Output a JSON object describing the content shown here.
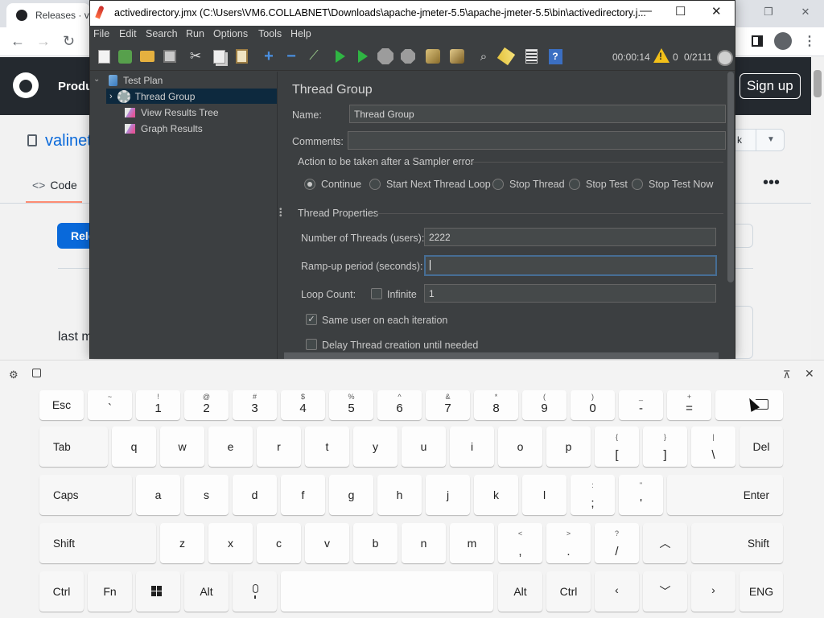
{
  "browser": {
    "tab_title": "Releases · va",
    "signup": "Sign up",
    "product_label": "Produ",
    "repo_name": "valinet",
    "code_tab": "Code",
    "releases_btn": "Rele",
    "last_text": "last m",
    "star_btn_text": "k"
  },
  "jmeter": {
    "window_title": "activedirectory.jmx (C:\\Users\\VM6.COLLABNET\\Downloads\\apache-jmeter-5.5\\apache-jmeter-5.5\\bin\\activedirectory.j...",
    "menu": [
      "File",
      "Edit",
      "Search",
      "Run",
      "Options",
      "Tools",
      "Help"
    ],
    "timer": "00:00:14",
    "error_count": "0",
    "threads": "0/2111",
    "tree": [
      {
        "label": "Test Plan",
        "icon": "test-plan-icon"
      },
      {
        "label": "Thread Group",
        "icon": "gear-icon",
        "selected": true
      },
      {
        "label": "View Results Tree",
        "icon": "graph-icon"
      },
      {
        "label": "Graph Results",
        "icon": "graph-icon"
      }
    ],
    "panel": {
      "heading": "Thread Group",
      "name_label": "Name:",
      "name_value": "Thread Group",
      "comments_label": "Comments:",
      "comments_value": "",
      "error_action_title": "Action to be taken after a Sampler error",
      "error_actions": [
        "Continue",
        "Start Next Thread Loop",
        "Stop Thread",
        "Stop Test",
        "Stop Test Now"
      ],
      "error_action_selected": "Continue",
      "props_title": "Thread Properties",
      "threads_label": "Number of Threads (users):",
      "threads_value": "2222",
      "rampup_label": "Ramp-up period (seconds):",
      "rampup_value": "",
      "loop_label": "Loop Count:",
      "infinite_label": "Infinite",
      "infinite_checked": false,
      "loop_value": "1",
      "same_user_label": "Same user on each iteration",
      "same_user_checked": true,
      "delay_label": "Delay Thread creation until needed",
      "delay_checked": false
    }
  },
  "keyboard": {
    "row1": [
      {
        "main": "Esc"
      },
      {
        "shift": "~",
        "main": "`"
      },
      {
        "shift": "!",
        "main": "1"
      },
      {
        "shift": "@",
        "main": "2"
      },
      {
        "shift": "#",
        "main": "3"
      },
      {
        "shift": "$",
        "main": "4"
      },
      {
        "shift": "%",
        "main": "5"
      },
      {
        "shift": "^",
        "main": "6"
      },
      {
        "shift": "&",
        "main": "7"
      },
      {
        "shift": "*",
        "main": "8"
      },
      {
        "shift": "(",
        "main": "9"
      },
      {
        "shift": ")",
        "main": "0"
      },
      {
        "shift": "_",
        "main": "-"
      },
      {
        "shift": "+",
        "main": "="
      }
    ],
    "row2": [
      "Tab",
      "q",
      "w",
      "e",
      "r",
      "t",
      "y",
      "u",
      "i",
      "o",
      "p",
      "Del"
    ],
    "row2_sym": [
      {
        "shift": "{",
        "main": "["
      },
      {
        "shift": "}",
        "main": "]"
      },
      {
        "shift": "|",
        "main": "\\"
      }
    ],
    "row3": [
      "Caps",
      "a",
      "s",
      "d",
      "f",
      "g",
      "h",
      "j",
      "k",
      "l",
      "Enter"
    ],
    "row3_sym": [
      {
        "shift": ":",
        "main": ";"
      },
      {
        "shift": "\"",
        "main": "'"
      }
    ],
    "row4": [
      "Shift",
      "z",
      "x",
      "c",
      "v",
      "b",
      "n",
      "m",
      "Shift"
    ],
    "row4_sym": [
      {
        "shift": "<",
        "main": ","
      },
      {
        "shift": ">",
        "main": "."
      },
      {
        "shift": "?",
        "main": "/"
      }
    ],
    "row5": [
      "Ctrl",
      "Fn",
      "Alt",
      "Alt",
      "Ctrl",
      "ENG"
    ]
  }
}
